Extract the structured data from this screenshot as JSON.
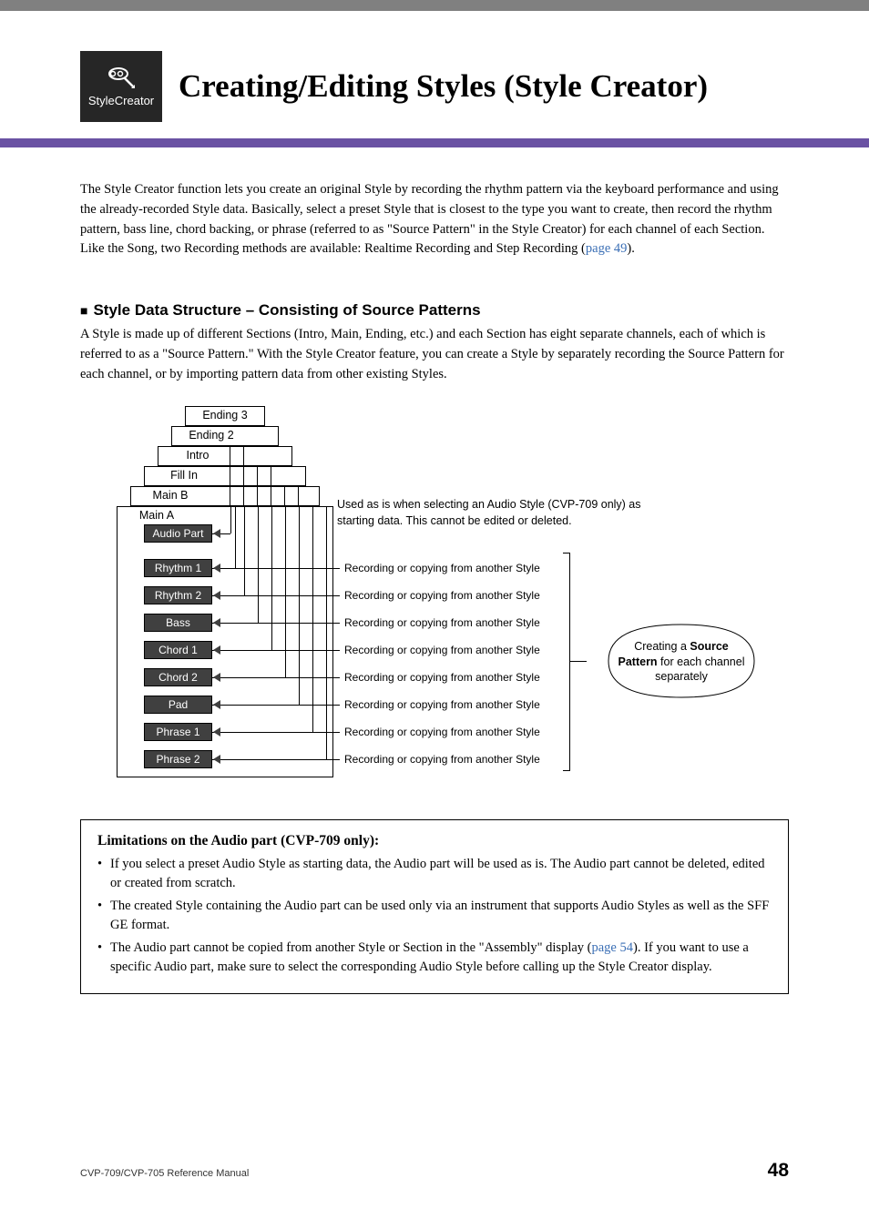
{
  "header": {
    "badge_label": "StyleCreator",
    "title": "Creating/Editing Styles (Style Creator)"
  },
  "intro": {
    "text_before_link": "The Style Creator function lets you create an original Style by recording the rhythm pattern via the keyboard performance and using the already-recorded Style data. Basically, select a preset Style that is closest to the type you want to create, then record the rhythm pattern, bass line, chord backing, or phrase (referred to as \"Source Pattern\" in the Style Creator) for each channel of each Section. Like the Song, two Recording methods are available: Realtime Recording and Step Recording (",
    "link": "page 49",
    "text_after_link": ")."
  },
  "structure_section": {
    "heading": "Style Data Structure – Consisting of Source Patterns",
    "para": "A Style is made up of different Sections (Intro, Main, Ending, etc.) and each Section has eight separate channels, each of which is referred to as a \"Source Pattern.\" With the Style Creator feature, you can create a Style by separately recording the Source Pattern for each channel, or by importing pattern data from other existing Styles."
  },
  "diagram": {
    "sections": [
      "Ending 3",
      "Ending 2",
      "Intro",
      "Fill In",
      "Main B",
      "Main A"
    ],
    "channels": [
      "Audio Part",
      "Rhythm 1",
      "Rhythm 2",
      "Bass",
      "Chord 1",
      "Chord 2",
      "Pad",
      "Phrase 1",
      "Phrase 2"
    ],
    "audio_note": "Used as is when selecting an Audio Style (CVP-709 only) as starting data. This cannot be edited or deleted.",
    "rec_label": "Recording or copying from another Style",
    "ellipse_line1": "Creating a ",
    "ellipse_bold1": "Source",
    "ellipse_bold2": "Pattern",
    "ellipse_line2": " for each channel separately"
  },
  "limitations": {
    "title": "Limitations on the Audio part (CVP-709 only):",
    "items": [
      {
        "text": "If you select a preset Audio Style as starting data, the Audio part will be used as is. The Audio part cannot be deleted, edited or created from scratch."
      },
      {
        "text": "The created Style containing the Audio part can be used only via an instrument that supports Audio Styles as well as the SFF GE format."
      },
      {
        "before": "The Audio part cannot be copied from another Style or Section in the \"Assembly\" display (",
        "link": "page 54",
        "after": "). If you want to use a specific Audio part, make sure to select the corresponding Audio Style before calling up the Style Creator display."
      }
    ]
  },
  "footer": {
    "left": "CVP-709/CVP-705 Reference Manual",
    "page": "48"
  }
}
